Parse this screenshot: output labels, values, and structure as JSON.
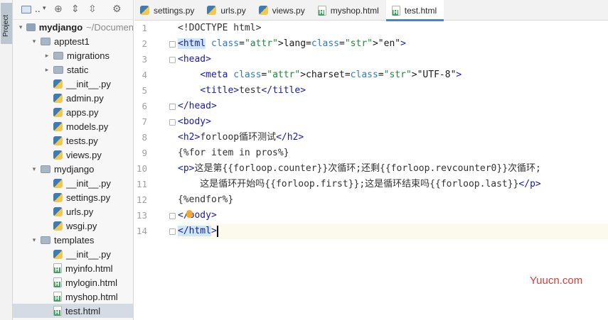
{
  "sidebar_strip": {
    "label": "Project"
  },
  "panel_toolbar": {
    "dropdown_label": "..",
    "dropdown_arrow": "▾"
  },
  "tree": [
    {
      "label": "mydjango",
      "suffix": "~/Documen",
      "type": "root",
      "depth": 0,
      "expanded": true
    },
    {
      "label": "apptest1",
      "type": "folder",
      "depth": 1,
      "expanded": true
    },
    {
      "label": "migrations",
      "type": "folder",
      "depth": 2,
      "expanded": false
    },
    {
      "label": "static",
      "type": "folder",
      "depth": 2,
      "expanded": false
    },
    {
      "label": "__init__.py",
      "type": "py",
      "depth": 2
    },
    {
      "label": "admin.py",
      "type": "py",
      "depth": 2
    },
    {
      "label": "apps.py",
      "type": "py",
      "depth": 2
    },
    {
      "label": "models.py",
      "type": "py",
      "depth": 2
    },
    {
      "label": "tests.py",
      "type": "py",
      "depth": 2
    },
    {
      "label": "views.py",
      "type": "py",
      "depth": 2
    },
    {
      "label": "mydjango",
      "type": "folder",
      "depth": 1,
      "expanded": true
    },
    {
      "label": "__init__.py",
      "type": "py",
      "depth": 2
    },
    {
      "label": "settings.py",
      "type": "py",
      "depth": 2
    },
    {
      "label": "urls.py",
      "type": "py",
      "depth": 2
    },
    {
      "label": "wsgi.py",
      "type": "py",
      "depth": 2
    },
    {
      "label": "templates",
      "type": "folder",
      "depth": 1,
      "expanded": true
    },
    {
      "label": "__init__.py",
      "type": "py",
      "depth": 2
    },
    {
      "label": "myinfo.html",
      "type": "html",
      "depth": 2
    },
    {
      "label": "mylogin.html",
      "type": "html",
      "depth": 2
    },
    {
      "label": "myshop.html",
      "type": "html",
      "depth": 2
    },
    {
      "label": "test.html",
      "type": "html",
      "depth": 2,
      "selected": true
    }
  ],
  "tabs": [
    {
      "label": "settings.py",
      "type": "py"
    },
    {
      "label": "urls.py",
      "type": "py"
    },
    {
      "label": "views.py",
      "type": "py"
    },
    {
      "label": "myshop.html",
      "type": "html"
    },
    {
      "label": "test.html",
      "type": "html",
      "active": true
    }
  ],
  "editor": {
    "current_line": 14,
    "lines": [
      {
        "n": "1",
        "text": "<!DOCTYPE html>"
      },
      {
        "n": "2",
        "text": "<html lang=\"en\">"
      },
      {
        "n": "3",
        "text": "<head>"
      },
      {
        "n": "4",
        "text": "    <meta charset=\"UTF-8\">"
      },
      {
        "n": "5",
        "text": "    <title>test</title>"
      },
      {
        "n": "6",
        "text": "</head>"
      },
      {
        "n": "7",
        "text": "<body>"
      },
      {
        "n": "8",
        "text": "<h2>forloop循环测试</h2>"
      },
      {
        "n": "9",
        "text": "{%for item in pros%}"
      },
      {
        "n": "10",
        "text": "<p>这是第{{forloop.counter}}次循环;还剩{{forloop.revcounter0}}次循环;"
      },
      {
        "n": "11",
        "text": "    这是循环开始吗{{forloop.first}};这是循环结束吗{{forloop.last}}</p>"
      },
      {
        "n": "12",
        "text": "{%endfor%}"
      },
      {
        "n": "13",
        "text": "</body>"
      },
      {
        "n": "14",
        "text": "</html>"
      }
    ]
  },
  "watermark": "Yuucn.com",
  "colors": {
    "tag": "#1a1aa6",
    "attr": "#2e7bc2",
    "string": "#1d8a3a",
    "active_tab_underline": "#4a7fd4",
    "selection": "#d4dbe5"
  }
}
